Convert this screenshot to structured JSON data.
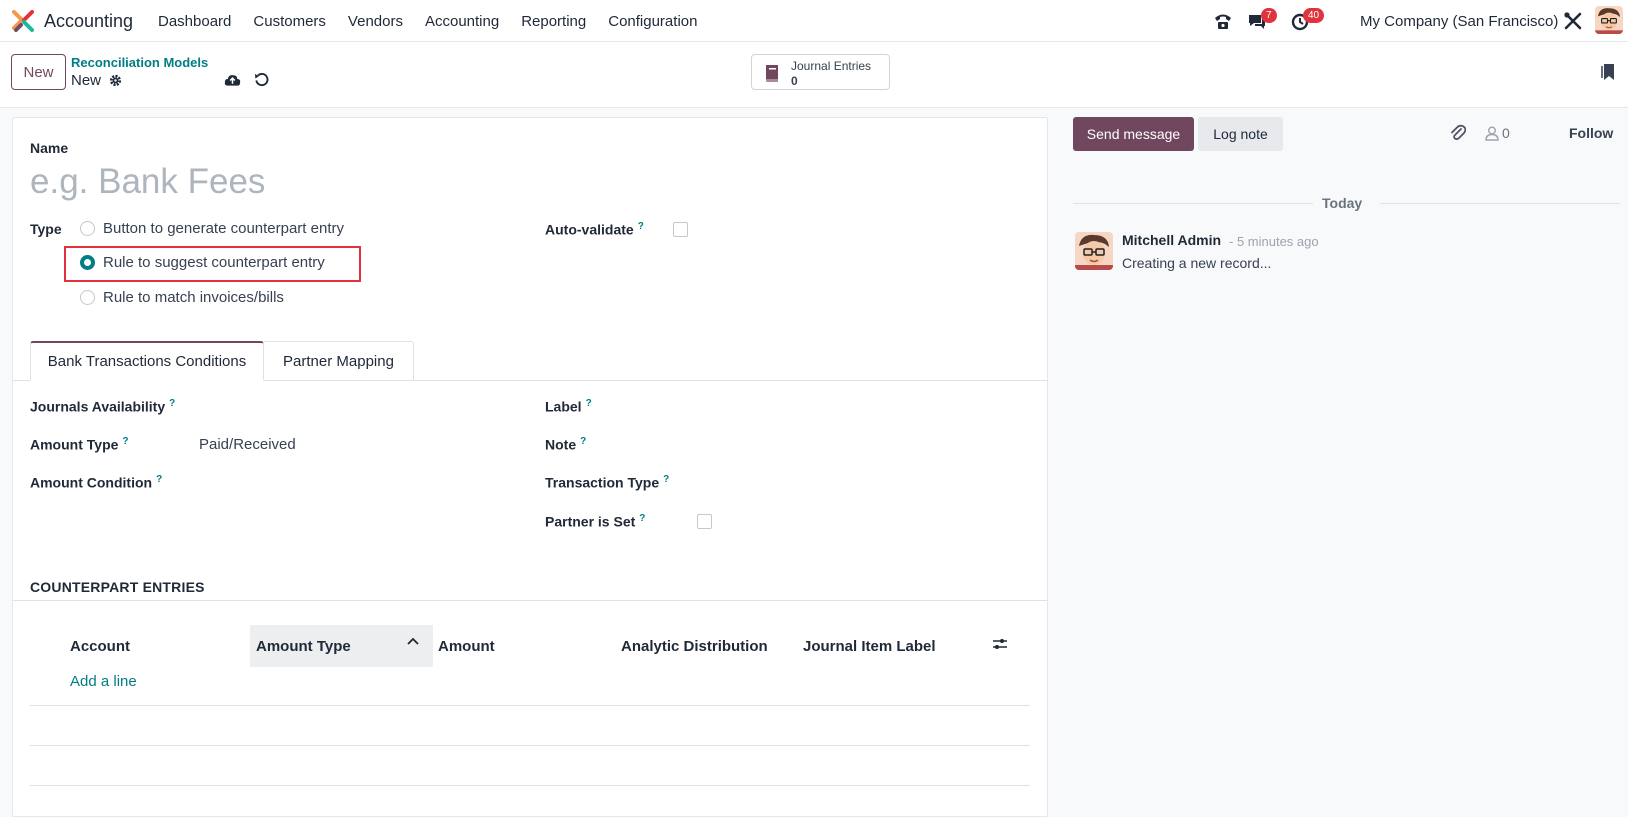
{
  "navbar": {
    "app_name": "Accounting",
    "menu": [
      "Dashboard",
      "Customers",
      "Vendors",
      "Accounting",
      "Reporting",
      "Configuration"
    ],
    "messages_badge": "7",
    "activities_badge": "40",
    "company": "My Company (San Francisco)"
  },
  "control": {
    "new_label": "New",
    "breadcrumb_parent": "Reconciliation Models",
    "breadcrumb_current": "New",
    "smart_button": {
      "label": "Journal Entries",
      "value": "0"
    }
  },
  "form": {
    "name_label": "Name",
    "name_placeholder": "e.g. Bank Fees",
    "type_label": "Type",
    "type_options": [
      {
        "label": "Button to generate counterpart entry",
        "checked": false
      },
      {
        "label": "Rule to suggest counterpart entry",
        "checked": true
      },
      {
        "label": "Rule to match invoices/bills",
        "checked": false
      }
    ],
    "auto_validate_label": "Auto-validate",
    "help_mark": "?",
    "tabs": [
      "Bank Transactions Conditions",
      "Partner Mapping"
    ],
    "fields_left": [
      {
        "label": "Journals Availability",
        "value": ""
      },
      {
        "label": "Amount Type",
        "value": "Paid/Received"
      },
      {
        "label": "Amount Condition",
        "value": ""
      }
    ],
    "fields_right": [
      {
        "label": "Label"
      },
      {
        "label": "Note"
      },
      {
        "label": "Transaction Type"
      },
      {
        "label": "Partner is Set"
      }
    ],
    "counterpart_title": "COUNTERPART ENTRIES",
    "columns": [
      "Account",
      "Amount Type",
      "Amount",
      "Analytic Distribution",
      "Journal Item Label"
    ],
    "add_line": "Add a line"
  },
  "chatter": {
    "send_message": "Send message",
    "log_note": "Log note",
    "followers_count": "0",
    "follow": "Follow",
    "date_separator": "Today",
    "message": {
      "author": "Mitchell Admin",
      "time": "- 5 minutes ago",
      "body": "Creating a new record..."
    }
  },
  "colors": {
    "brand": "#71475f",
    "accent": "#017e84",
    "highlight": "#e0333d"
  }
}
